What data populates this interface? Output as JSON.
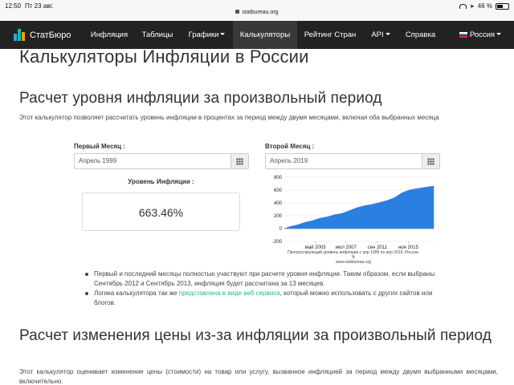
{
  "status_bar": {
    "time": "12:50",
    "date": "Пт 23 авг.",
    "url": "statbureau.org",
    "battery": "46 %"
  },
  "navbar": {
    "brand": "СтатБюро",
    "items": [
      {
        "label": "Инфляция"
      },
      {
        "label": "Таблицы"
      },
      {
        "label": "Графики"
      },
      {
        "label": "Калькуляторы"
      },
      {
        "label": "Рейтинг Стран"
      },
      {
        "label": "API"
      },
      {
        "label": "Справка"
      },
      {
        "label": "Россия"
      }
    ],
    "active_color": "#393939",
    "bg_color": "#222222"
  },
  "page": {
    "title": "Калькуляторы Инфляции в России",
    "section1": {
      "title": "Расчет уровня инфляции за произвольный период",
      "lead": "Этот калькулятор позволяет рассчитать уровень инфляции в процентах за период между двумя месяцами, включая оба выбранных месяца"
    },
    "calculator": {
      "first_month_label": "Первый Месяц :",
      "first_month_value": "Апрель 1999",
      "second_month_label": "Второй Месяц :",
      "second_month_value": "Апрель 2019",
      "result_label": "Уровень Инфляции :",
      "result_value": "663.46%"
    },
    "bullets": {
      "item1": "Первый и последний месяцы полностью участвуют при расчете уровня инфляции. Таким образом, если выбраны Сентябрь 2012 и Сентябрь 2013, инфляция будет рассчитана за 13 месяцев.",
      "item2_before": "Логика калькулятора так же ",
      "item2_link": "представлена в виде веб сервиса",
      "item2_after": ", который можно использовать с других сайтов или блогов."
    },
    "section2": {
      "title": "Расчет изменения цены из-за инфляции за произвольный период",
      "lead": "Этот калькулятор оценивает изменение цены (стоимости) на товар или услугу, вызванное инфляцией за период между двумя выбранными месяцами, включительно."
    }
  },
  "chart_data": {
    "type": "area",
    "color": "#2a7fe0",
    "y_ticks": [
      "800",
      "600",
      "400",
      "200",
      "0",
      "-200"
    ],
    "ylim": [
      -200,
      800
    ],
    "x_ticks": [
      "май 2003",
      "июл 2007",
      "сен 2011",
      "ноя 2015"
    ],
    "x": [
      1999.25,
      2000,
      2001,
      2002,
      2003,
      2004,
      2005,
      2006,
      2007,
      2008,
      2009,
      2010,
      2011,
      2012,
      2013,
      2014,
      2015,
      2016,
      2017,
      2018,
      2019.25
    ],
    "values": [
      0,
      30,
      60,
      95,
      125,
      160,
      185,
      215,
      240,
      280,
      330,
      355,
      380,
      405,
      440,
      480,
      560,
      600,
      625,
      640,
      663
    ],
    "caption_lines": [
      "Прогрессирующий уровень инфляции с апр 1999 по апр 2019, Россия,",
      "%",
      "www.statbureau.org"
    ]
  }
}
